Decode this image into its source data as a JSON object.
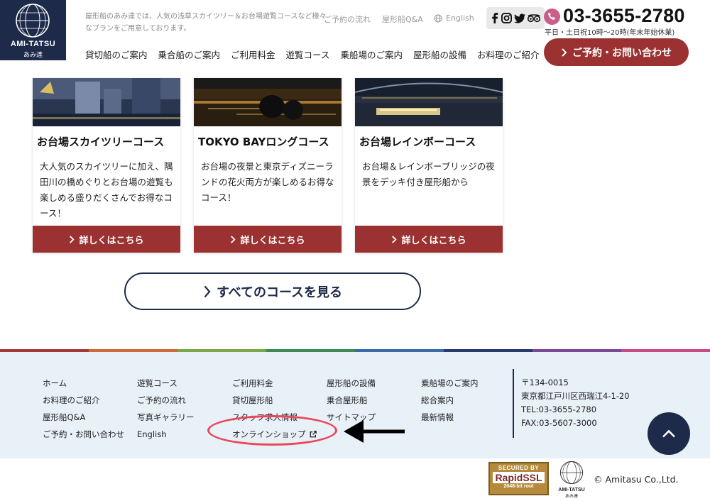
{
  "header": {
    "logo_name": "AMI-TATSU",
    "logo_sub": "あみ達",
    "tagline": "屋形船のあみ達では、人気の浅草スカイツリー＆お台場遊覧コースなど様々なプランをご用意しております。",
    "top_links": [
      "ご予約の流れ",
      "屋形船Q&A",
      "English"
    ],
    "phone": "03-3655-2780",
    "hours": "平日・土日祝10時〜20時(年末年始休業)",
    "nav": [
      "貸切船のご案内",
      "乗合船のご案内",
      "ご利用料金",
      "遊覧コース",
      "乗船場のご案内",
      "屋形船の設備",
      "お料理のご紹介"
    ],
    "contact_button": "ご予約・お問い合わせ"
  },
  "courses": [
    {
      "title": "お台場スカイツリーコース",
      "text": "大人気のスカイツリーに加え、隅田川の橋めぐりとお台場の遊覧も楽しめる盛りだくさんでお得なコース！",
      "button": "詳しくはこちら"
    },
    {
      "title": "TOKYO BAYロングコース",
      "text": "お台場の夜景と東京ディズニーランドの花火両方が楽しめるお得なコース！",
      "button": "詳しくはこちら"
    },
    {
      "title": "お台場レインボーコース",
      "text": "お台場＆レインボーブリッジの夜景をデッキ付き屋形船から",
      "button": "詳しくはこちら"
    }
  ],
  "all_courses_button": "すべてのコースを見る",
  "footer": {
    "col1": [
      "ホーム",
      "お料理のご紹介",
      "屋形船Q&A",
      "ご予約・お問い合わせ"
    ],
    "col2": [
      "遊覧コース",
      "ご予約の流れ",
      "写真ギャラリー",
      "English"
    ],
    "col3": [
      "ご利用料金",
      "貸切屋形船",
      "スタッフ求人情報",
      "オンラインショップ"
    ],
    "col4": [
      "屋形船の設備",
      "乗合屋形船",
      "サイトマップ"
    ],
    "col5": [
      "乗船場のご案内",
      "総合案内",
      "最新情報"
    ],
    "address": [
      "〒134-0015",
      "東京都江戸川区西瑞江4-1-20",
      "TEL:03-3655-2780",
      "FAX:03-5607-3000"
    ],
    "ssl": {
      "line1": "SECURED BY",
      "line2": "RapidSSL",
      "line3": "2048-bit root"
    },
    "copyright": "© Amitasu Co.,Ltd."
  },
  "colors": {
    "navy": "#1e2a4a",
    "brand_red": "#9b3131",
    "highlight": "#e8485a",
    "footer_bg": "#e8f0f8"
  }
}
